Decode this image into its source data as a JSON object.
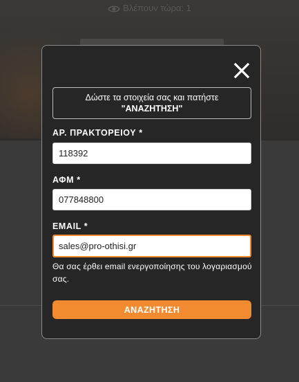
{
  "background": {
    "viewers_text": "Βλέπουν τώρα: 1"
  },
  "modal": {
    "info_line1": "Δώστε τα στοιχεία σας και πατήστε",
    "info_line2": "\"ΑΝΑΖΗΤΗΣΗ\"",
    "fields": {
      "agency": {
        "label": "ΑΡ. ΠΡΑΚΤΟΡΕΙΟΥ *",
        "value": "118392"
      },
      "afm": {
        "label": "ΑΦΜ *",
        "value": "077848800"
      },
      "email": {
        "label": "EMAIL *",
        "value": "sales@pro-othisi.gr"
      }
    },
    "note": "Θα σας έρθει email ενεργοποίησης του λογαριασμού σας.",
    "search_label": "ΑΝΑΖΗΤΗΣΗ"
  },
  "colors": {
    "accent": "#f28b30",
    "modal_bg": "#262626",
    "page_bg": "#353535"
  },
  "icons": [
    "eye-icon",
    "close-icon"
  ]
}
